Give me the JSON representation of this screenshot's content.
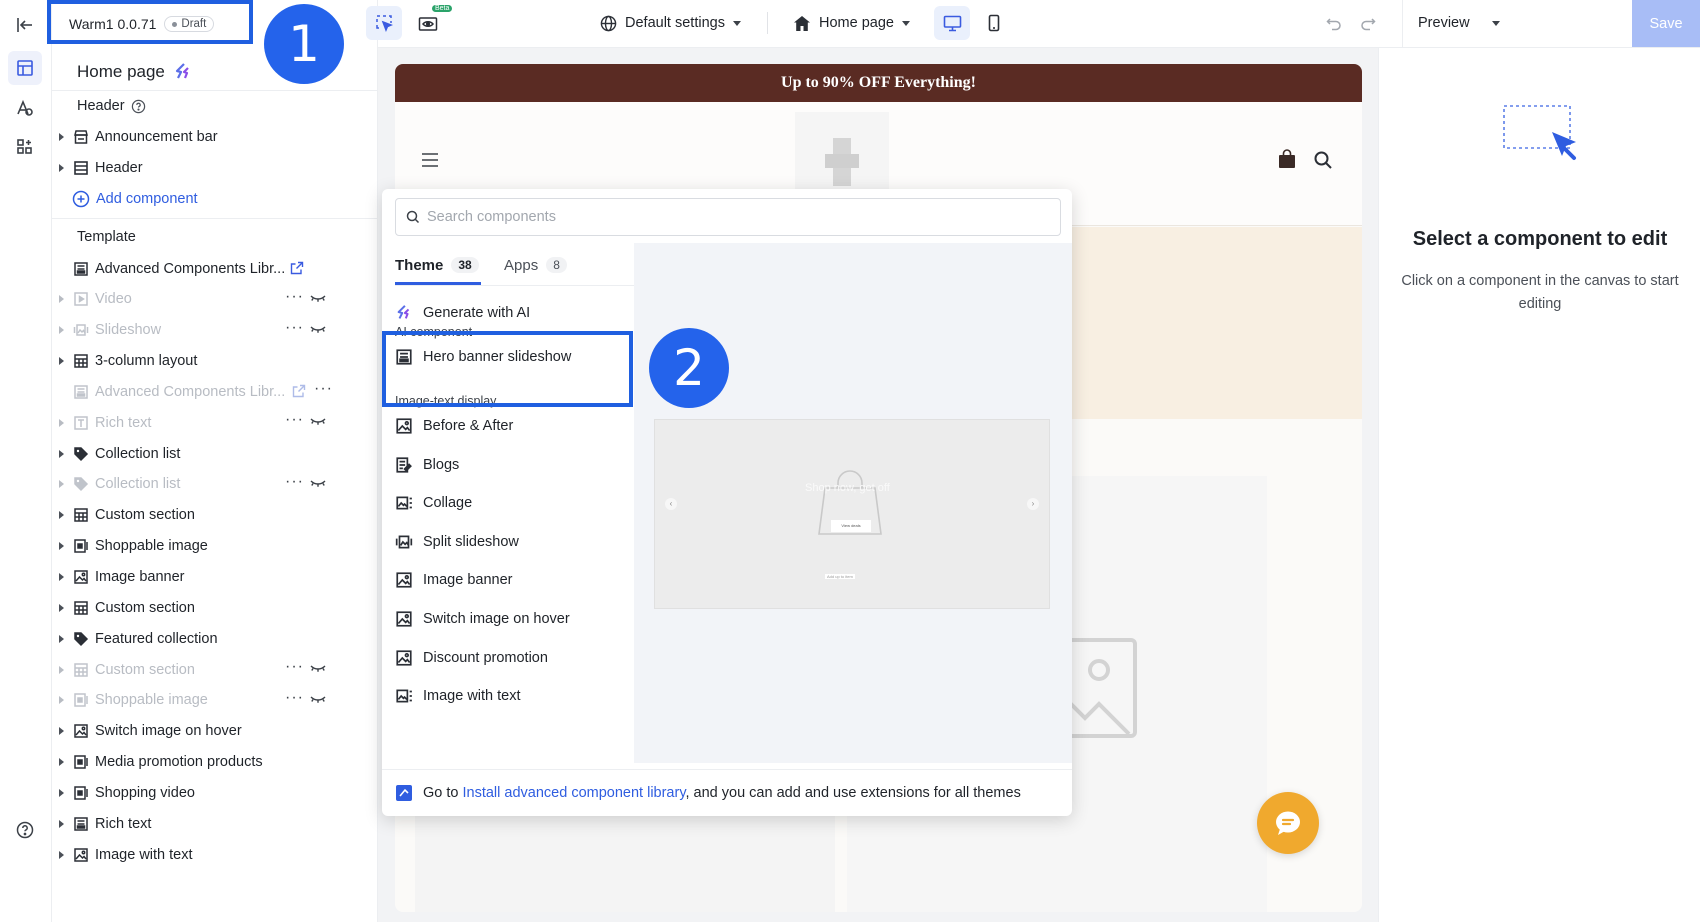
{
  "app": {
    "version_label": "Warm1 0.0.71",
    "status_badge": "Draft",
    "accent_color": "#2f5de0",
    "annotation_1": "1",
    "annotation_2": "2"
  },
  "panel": {
    "page_title": "Home page",
    "header_section": "Header",
    "header_items": [
      {
        "label": "Announcement bar",
        "icon": "store-icon"
      },
      {
        "label": "Header",
        "icon": "layout-icon"
      }
    ],
    "add_component": "Add component",
    "template_section": "Template",
    "template_items": [
      {
        "label": "Advanced Components Libr...",
        "icon": "block-icon",
        "dim": false,
        "caret": false,
        "external": true
      },
      {
        "label": "Video",
        "icon": "video-icon",
        "dim": true,
        "caret": true,
        "hidden": true
      },
      {
        "label": "Slideshow",
        "icon": "slideshow-icon",
        "dim": true,
        "caret": true,
        "hidden": true
      },
      {
        "label": "3-column layout",
        "icon": "columns-icon",
        "dim": false,
        "caret": true
      },
      {
        "label": "Advanced Components Libr...",
        "icon": "block-icon",
        "dim": true,
        "caret": false,
        "external": true,
        "more": true
      },
      {
        "label": "Rich text",
        "icon": "text-icon",
        "dim": true,
        "caret": true,
        "hidden": true
      },
      {
        "label": "Collection list",
        "icon": "tag-icon",
        "dim": false,
        "caret": true
      },
      {
        "label": "Collection list",
        "icon": "tag-icon",
        "dim": true,
        "caret": true,
        "hidden": true
      },
      {
        "label": "Custom section",
        "icon": "columns-icon",
        "dim": false,
        "caret": true
      },
      {
        "label": "Shoppable image",
        "icon": "shoppable-icon",
        "dim": false,
        "caret": true
      },
      {
        "label": "Image banner",
        "icon": "image-icon",
        "dim": false,
        "caret": true
      },
      {
        "label": "Custom section",
        "icon": "columns-icon",
        "dim": false,
        "caret": true
      },
      {
        "label": "Featured collection",
        "icon": "tag-icon",
        "dim": false,
        "caret": true
      },
      {
        "label": "Custom section",
        "icon": "columns-icon",
        "dim": true,
        "caret": true,
        "hidden": true
      },
      {
        "label": "Shoppable image",
        "icon": "shoppable-icon",
        "dim": true,
        "caret": true,
        "hidden": true
      },
      {
        "label": "Switch image on hover",
        "icon": "image-icon",
        "dim": false,
        "caret": true
      },
      {
        "label": "Media promotion products",
        "icon": "shoppable-icon",
        "dim": false,
        "caret": true
      },
      {
        "label": "Shopping video",
        "icon": "shoppable-icon",
        "dim": false,
        "caret": true
      },
      {
        "label": "Rich text",
        "icon": "block-icon",
        "dim": false,
        "caret": true
      },
      {
        "label": "Image with text",
        "icon": "image-icon",
        "dim": false,
        "caret": true
      }
    ]
  },
  "toolbar": {
    "settings_label": "Default settings",
    "page_label": "Home page",
    "beta_label": "Beta",
    "preview_label": "Preview",
    "save_label": "Save"
  },
  "store": {
    "announcement": "Up to 90% OFF Everything!"
  },
  "dropdown": {
    "search_placeholder": "Search components",
    "tabs": [
      {
        "label": "Theme",
        "count": "38"
      },
      {
        "label": "Apps",
        "count": "8"
      }
    ],
    "generate_ai": "Generate with AI",
    "ai_group": "AI component",
    "ai_items": [
      {
        "label": "Hero banner slideshow",
        "icon": "block-icon"
      }
    ],
    "imgtext_group": "Image-text display",
    "imgtext_items": [
      {
        "label": "Before & After",
        "icon": "image-icon"
      },
      {
        "label": "Blogs",
        "icon": "blog-icon"
      },
      {
        "label": "Collage",
        "icon": "collage-icon"
      },
      {
        "label": "Split slideshow",
        "icon": "slideshow-icon"
      },
      {
        "label": "Image banner",
        "icon": "image-icon"
      },
      {
        "label": "Switch image on hover",
        "icon": "image-icon"
      },
      {
        "label": "Discount promotion",
        "icon": "image-icon"
      },
      {
        "label": "Image with text",
        "icon": "collage-icon"
      }
    ],
    "footer_prefix": "Go to ",
    "footer_link": "Install advanced component library",
    "footer_suffix": ", and you can add and use extensions for all themes",
    "preview_text": "Shop now, get off",
    "preview_button": "View deals",
    "preview_caption": "Add up to item"
  },
  "right_panel": {
    "title": "Select a component to edit",
    "description": "Click on a component in the canvas to start editing"
  }
}
